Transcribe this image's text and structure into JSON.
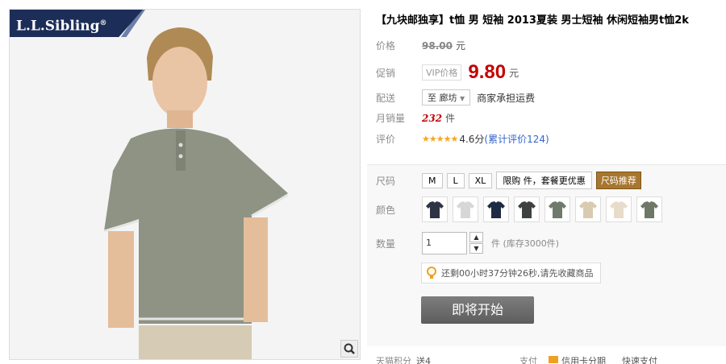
{
  "image": {
    "brand_name": "L.L.Sibling",
    "brand_mark": "®",
    "zoom_icon": "magnifier-icon"
  },
  "product": {
    "title": "【九块邮独享】t恤 男 短袖 2013夏装 男士短袖 休闲短袖男t恤2k"
  },
  "price": {
    "label": "价格",
    "value": "98.00",
    "unit": "元"
  },
  "promo": {
    "label": "促销",
    "vip_tag": "VIP价格",
    "value": "9.80",
    "unit": "元"
  },
  "shipping": {
    "label": "配送",
    "destination": "至 廊坊",
    "note": "商家承担运费"
  },
  "sales": {
    "label": "月销量",
    "value": "232",
    "unit": "件"
  },
  "rating": {
    "label": "评价",
    "stars": "★★★★★",
    "score": "4.6分",
    "reviews": "(累计评价124)"
  },
  "options": {
    "size_label": "尺码",
    "sizes": [
      "M",
      "L",
      "XL"
    ],
    "limit_text": "限购   件，套餐更优惠",
    "size_chart": "尺码推荐",
    "color_label": "颜色",
    "colors": [
      "#2e3444",
      "#d7d7d7",
      "#1f2a44",
      "#3d4240",
      "#6f7a6a",
      "#d9cbb0",
      "#e7dccb",
      "#6f7867"
    ],
    "qty_label": "数量",
    "qty_value": "1",
    "stock_text": "件 (库存3000件)",
    "timer_text": "还剩00小时37分钟26秒,请先收藏商品",
    "buy_label": "即将开始"
  },
  "footer": {
    "left": "天猫积分",
    "left_value": "送4",
    "pay_label": "支付",
    "pay_method": "信用卡分期",
    "quick": "快速支付"
  }
}
